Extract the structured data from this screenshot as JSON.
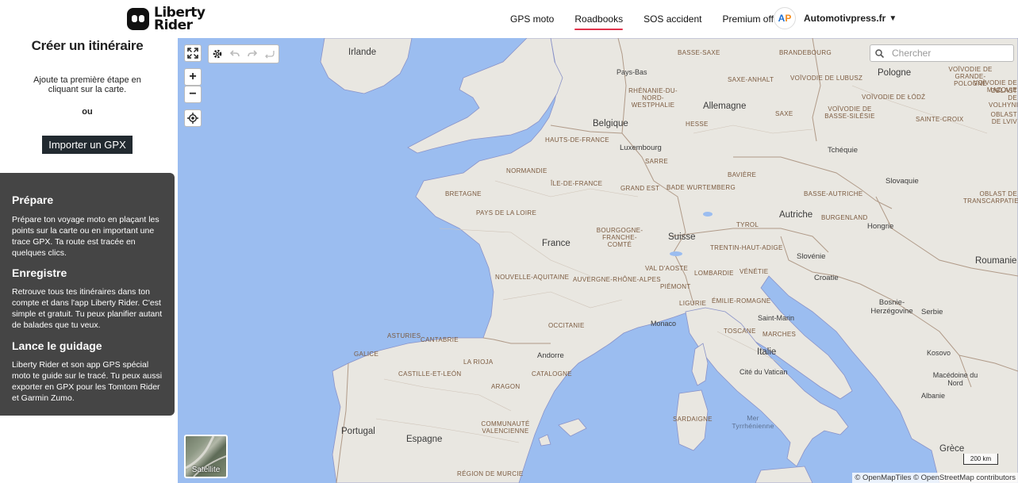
{
  "brand": {
    "logo_line1": "Liberty",
    "logo_line2": "Rider"
  },
  "nav": {
    "items": [
      {
        "label": "GPS moto",
        "active": false
      },
      {
        "label": "Roadbooks",
        "active": true
      },
      {
        "label": "SOS accident",
        "active": false
      },
      {
        "label": "Premium offert",
        "active": false
      }
    ],
    "account": {
      "avatar_initial_1": "A",
      "avatar_initial_2": "P",
      "name": "Automotivpress.fr",
      "caret": "▼"
    },
    "active_color": "#e0324b"
  },
  "left_panel": {
    "title": "Créer un itinéraire",
    "hint": "Ajoute ta première étape en cliquant sur la carte.",
    "or": "ou",
    "import_button": "Importer un GPX",
    "sections": [
      {
        "title": "Prépare",
        "text": "Prépare ton voyage moto en plaçant les points sur la carte ou en important une trace GPX. Ta route est tracée en quelques clics."
      },
      {
        "title": "Enregistre",
        "text": "Retrouve tous tes itinéraires dans ton compte et dans l'app Liberty Rider. C'est simple et gratuit. Tu peux planifier autant de balades que tu veux."
      },
      {
        "title": "Lance le guidage",
        "text": "Liberty Rider et son app GPS spécial moto te guide sur le tracé. Tu peux aussi exporter en GPX pour les Tomtom Rider et Garmin Zumo."
      }
    ]
  },
  "map": {
    "search_placeholder": "Chercher",
    "satellite_label": "Satellite",
    "scale_label": "200 km",
    "attribution": "© OpenMapTiles © OpenStreetMap contributors",
    "colors": {
      "sea": "#9bbdf0",
      "land": "#e9e7e1"
    },
    "countries": [
      "Irlande",
      "Pays-Bas",
      "Belgique",
      "Luxembourg",
      "Allemagne",
      "Pologne",
      "Tchéquie",
      "Slovaquie",
      "Autriche",
      "Hongrie",
      "Suisse",
      "France",
      "Slovénie",
      "Croatie",
      "Roumanie",
      "Bosnie-Herzégovine",
      "Serbie",
      "Monaco",
      "Italie",
      "Saint-Marin",
      "Cité du Vatican",
      "Kosovo",
      "Andorre",
      "Portugal",
      "Espagne",
      "Macédoine du Nord",
      "Albanie",
      "Grèce"
    ],
    "regions": [
      "BASSE-SAXE",
      "BRANDEBOURG",
      "SAXE-ANHALT",
      "VOÏVODIE DE LUBUSZ",
      "VOÏVODIE DE GRANDE-POLOGNE",
      "VOÏVODIE DE MAZOVIE",
      "RHÉNANIE-DU-NORD-WESTPHALIE",
      "HESSE",
      "SAXE",
      "VOÏVODIE DE ŁÓDŹ",
      "OBLAST DE VOLHYNIE",
      "OBLAST DE LVIV",
      "VOÏVODIE DE BASSE-SILÉSIE",
      "SAINTE-CROIX",
      "HAUTS-DE-FRANCE",
      "SARRE",
      "BAVIÈRE",
      "NORMANDIE",
      "ÎLE-DE-FRANCE",
      "GRAND EST",
      "BADE WURTEMBERG",
      "BRETAGNE",
      "PAYS DE LA LOIRE",
      "BASSE-AUTRICHE",
      "BURGENLAND",
      "BOURGOGNE-FRANCHE-COMTÉ",
      "TYROL",
      "TRENTIN-HAUT-ADIGE",
      "VAL D'AOSTE",
      "LOMBARDIE",
      "VÉNÉTIE",
      "NOUVELLE-AQUITAINE",
      "AUVERGNE-RHÔNE-ALPES",
      "PIÉMONT",
      "LIGURIE",
      "ÉMILIE-ROMAGNE",
      "OCCITANIE",
      "TOSCANE",
      "MARCHES",
      "ASTURIES",
      "CANTABRIE",
      "GALICE",
      "LA RIOJA",
      "CASTILLE-ET-LEÓN",
      "CATALOGNE",
      "ARAGON",
      "COMMUNAUTÉ VALENCIENNE",
      "SARDAIGNE",
      "RÉGION DE MURCIE",
      "OBLAST DE TRANSCARPATIE"
    ],
    "seas": [
      "Mer Tyrrhénienne"
    ]
  }
}
